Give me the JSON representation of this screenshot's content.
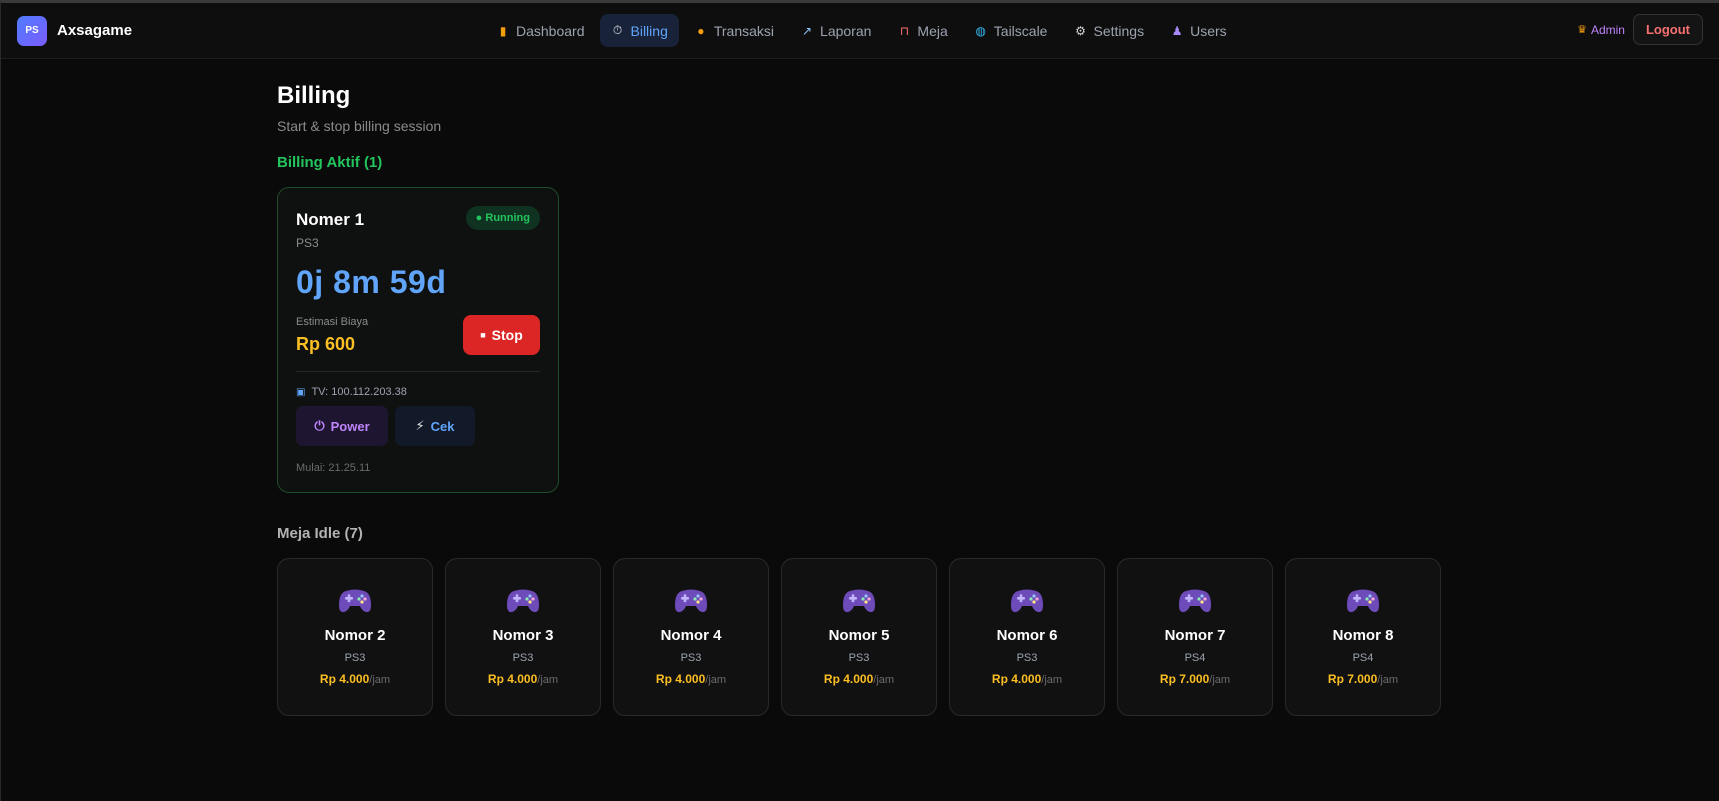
{
  "brand": {
    "logo": "PS",
    "name": "Axsagame"
  },
  "nav": [
    {
      "label": "Dashboard",
      "icon": "bar-chart-icon",
      "glyph": "▮"
    },
    {
      "label": "Billing",
      "icon": "timer-icon",
      "glyph": "⏱",
      "active": true
    },
    {
      "label": "Transaksi",
      "icon": "money-bag-icon",
      "glyph": "●"
    },
    {
      "label": "Laporan",
      "icon": "line-chart-icon",
      "glyph": "↗"
    },
    {
      "label": "Meja",
      "icon": "chair-icon",
      "glyph": "⊓"
    },
    {
      "label": "Tailscale",
      "icon": "globe-icon",
      "glyph": "◍"
    },
    {
      "label": "Settings",
      "icon": "gear-icon",
      "glyph": "⚙"
    },
    {
      "label": "Users",
      "icon": "users-icon",
      "glyph": "♟"
    }
  ],
  "user": {
    "role": "Admin",
    "logout": "Logout"
  },
  "page": {
    "title": "Billing",
    "subtitle": "Start & stop billing session"
  },
  "active": {
    "heading": "Billing Aktif (1)",
    "card": {
      "name": "Nomer 1",
      "type": "PS3",
      "status": "Running",
      "timer": "0j 8m 59d",
      "cost_label": "Estimasi Biaya",
      "cost": "Rp 600",
      "stop_label": "Stop",
      "tv": "TV: 100.112.203.38",
      "power_label": "Power",
      "cek_label": "Cek",
      "started": "Mulai: 21.25.11"
    }
  },
  "idle": {
    "heading": "Meja Idle (7)",
    "unit": "/jam",
    "items": [
      {
        "name": "Nomor 2",
        "type": "PS3",
        "price": "Rp 4.000"
      },
      {
        "name": "Nomor 3",
        "type": "PS3",
        "price": "Rp 4.000"
      },
      {
        "name": "Nomor 4",
        "type": "PS3",
        "price": "Rp 4.000"
      },
      {
        "name": "Nomor 5",
        "type": "PS3",
        "price": "Rp 4.000"
      },
      {
        "name": "Nomor 6",
        "type": "PS3",
        "price": "Rp 4.000"
      },
      {
        "name": "Nomor 7",
        "type": "PS4",
        "price": "Rp 7.000"
      },
      {
        "name": "Nomor 8",
        "type": "PS4",
        "price": "Rp 7.000"
      }
    ]
  },
  "colors": {
    "accent": "#60a5fa",
    "success": "#22c55e",
    "danger": "#dc2626",
    "price": "#fbbf24",
    "purple": "#c084fc"
  }
}
